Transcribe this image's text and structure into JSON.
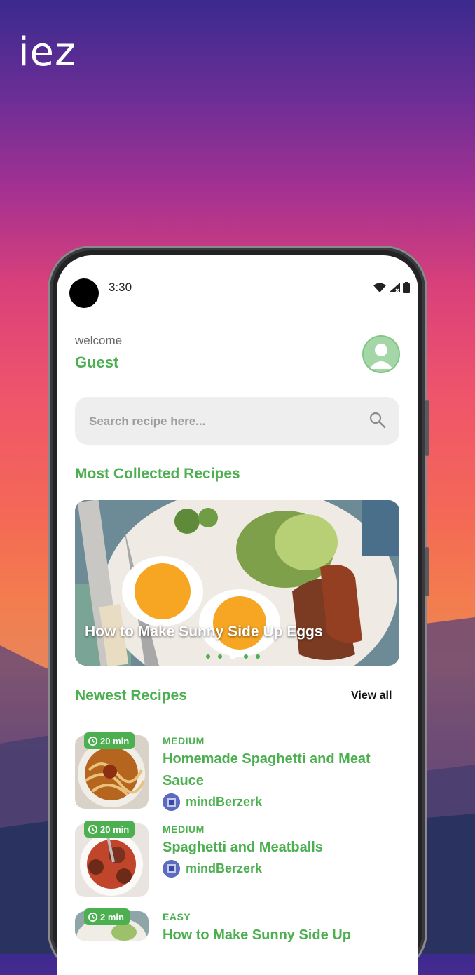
{
  "logo": {
    "text": "iez"
  },
  "status_bar": {
    "time": "3:30"
  },
  "header": {
    "welcome": "welcome",
    "username": "Guest"
  },
  "search": {
    "placeholder": "Search recipe here..."
  },
  "most_collected": {
    "title": "Most Collected Recipes",
    "slide_title": "How to Make Sunny Side Up Eggs",
    "active_slide": 3,
    "slide_count": 5
  },
  "newest": {
    "title": "Newest Recipes",
    "view_all": "View all",
    "recipes": [
      {
        "time": "20 min",
        "difficulty": "MEDIUM",
        "title": "Homemade Spaghetti and Meat Sauce",
        "author": "mindBerzerk"
      },
      {
        "time": "20 min",
        "difficulty": "MEDIUM",
        "title": "Spaghetti and Meatballs",
        "author": "mindBerzerk"
      },
      {
        "time": "2 min",
        "difficulty": "EASY",
        "title": "How to Make Sunny Side Up",
        "author": ""
      }
    ]
  },
  "colors": {
    "accent": "#4caf50",
    "search_bg": "#eeeeee"
  }
}
